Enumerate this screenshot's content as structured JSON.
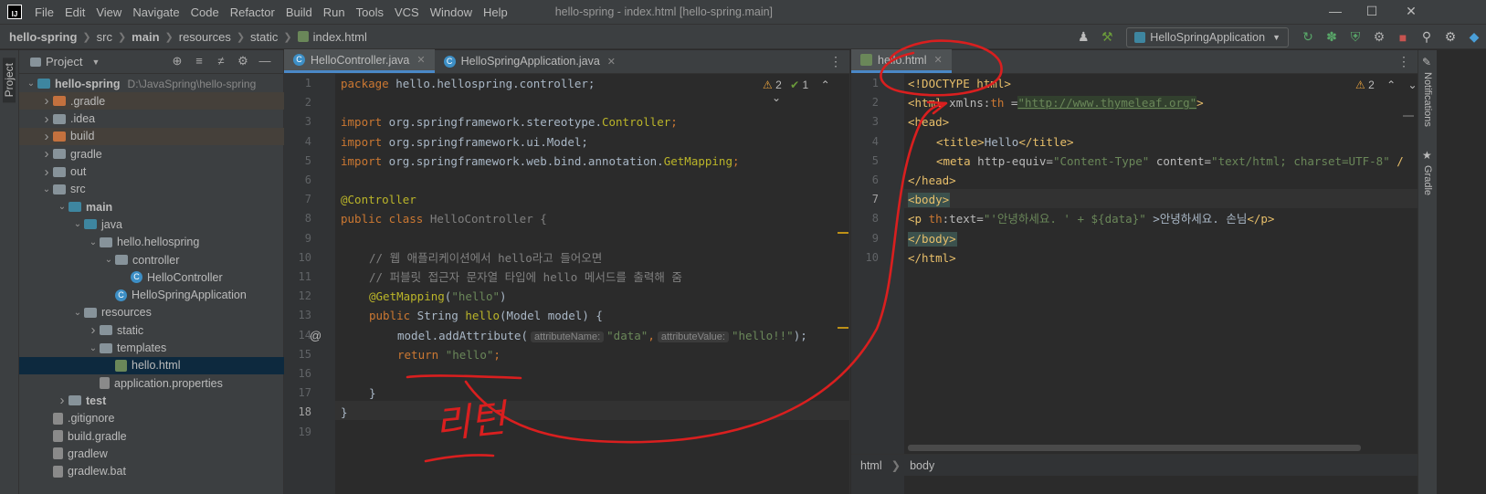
{
  "menubar": {
    "logo_text": "IJ",
    "items": [
      "File",
      "Edit",
      "View",
      "Navigate",
      "Code",
      "Refactor",
      "Build",
      "Run",
      "Tools",
      "VCS",
      "Window",
      "Help"
    ],
    "window_title": "hello-spring - index.html [hello-spring.main]"
  },
  "navbar": {
    "crumbs": [
      "hello-spring",
      "src",
      "main",
      "resources",
      "static",
      "index.html"
    ],
    "run_config": "HelloSpringApplication"
  },
  "left_strip": {
    "label": "Project"
  },
  "project": {
    "title": "Project",
    "tree": [
      {
        "label": "hello-spring",
        "extra": "D:\\JavaSpring\\hello-spring",
        "bold": true,
        "depth": 0,
        "arrow": "v",
        "icon": "folder-blue"
      },
      {
        "label": ".gradle",
        "depth": 1,
        "arrow": ">",
        "icon": "folder-orange",
        "hl": "brown"
      },
      {
        "label": ".idea",
        "depth": 1,
        "arrow": ">",
        "icon": "folder"
      },
      {
        "label": "build",
        "depth": 1,
        "arrow": ">",
        "icon": "folder-orange",
        "hl": "brown"
      },
      {
        "label": "gradle",
        "depth": 1,
        "arrow": ">",
        "icon": "folder"
      },
      {
        "label": "out",
        "depth": 1,
        "arrow": ">",
        "icon": "folder"
      },
      {
        "label": "src",
        "depth": 1,
        "arrow": "v",
        "icon": "folder"
      },
      {
        "label": "main",
        "depth": 2,
        "arrow": "v",
        "icon": "folder-blue",
        "bold": true
      },
      {
        "label": "java",
        "depth": 3,
        "arrow": "v",
        "icon": "folder-blue"
      },
      {
        "label": "hello.hellospring",
        "depth": 4,
        "arrow": "v",
        "icon": "folder"
      },
      {
        "label": "controller",
        "depth": 5,
        "arrow": "v",
        "icon": "folder"
      },
      {
        "label": "HelloController",
        "depth": 6,
        "arrow": "",
        "icon": "class"
      },
      {
        "label": "HelloSpringApplication",
        "depth": 5,
        "arrow": "",
        "icon": "class"
      },
      {
        "label": "resources",
        "depth": 3,
        "arrow": "v",
        "icon": "folder"
      },
      {
        "label": "static",
        "depth": 4,
        "arrow": ">",
        "icon": "folder"
      },
      {
        "label": "templates",
        "depth": 4,
        "arrow": "v",
        "icon": "folder"
      },
      {
        "label": "hello.html",
        "depth": 5,
        "arrow": "",
        "icon": "html",
        "hl": "sel"
      },
      {
        "label": "application.properties",
        "depth": 4,
        "arrow": "",
        "icon": "file"
      },
      {
        "label": "test",
        "depth": 2,
        "arrow": ">",
        "icon": "folder",
        "bold": true
      },
      {
        "label": ".gitignore",
        "depth": 1,
        "arrow": "",
        "icon": "file"
      },
      {
        "label": "build.gradle",
        "depth": 1,
        "arrow": "",
        "icon": "file"
      },
      {
        "label": "gradlew",
        "depth": 1,
        "arrow": "",
        "icon": "file"
      },
      {
        "label": "gradlew.bat",
        "depth": 1,
        "arrow": "",
        "icon": "file"
      }
    ]
  },
  "editor1": {
    "tabs": [
      "HelloController.java",
      "HelloSpringApplication.java"
    ],
    "inspections": {
      "warnings": "2",
      "ok": "1"
    },
    "line_numbers": [
      "1",
      "2",
      "3",
      "4",
      "5",
      "6",
      "7",
      "8",
      "9",
      "10",
      "11",
      "12",
      "13",
      "14",
      "15",
      "16",
      "17",
      "18",
      "19"
    ],
    "gutter_at": "@",
    "lines": {
      "l1": [
        "package",
        " hello.hellospring.controller;"
      ],
      "l3": [
        "import",
        " org.springframework.stereotype.",
        "Controller",
        ";"
      ],
      "l4": [
        "import",
        " org.springframework.ui.Model;"
      ],
      "l5": [
        "import",
        " org.springframework.web.bind.annotation.",
        "GetMapping",
        ";"
      ],
      "l7": "@Controller",
      "l8": [
        "public class",
        " HelloController {"
      ],
      "l10": "// 웹 애플리케이션에서 hello라고 들어오면",
      "l11": "// 퍼블릿 접근자 문자열 타입에 hello 메서드를 출력해 줌",
      "l12": [
        "@GetMapping",
        "(",
        "\"hello\"",
        ")"
      ],
      "l13": [
        "public",
        " String ",
        "hello",
        "(Model model) {"
      ],
      "l14": [
        "model.addAttribute(",
        "attributeName:",
        "\"data\"",
        ",",
        "attributeValue:",
        "\"hello!!\"",
        ");"
      ],
      "l15": [
        "return",
        " ",
        "\"hello\"",
        ";"
      ],
      "l17": "}",
      "l18": "}"
    }
  },
  "editor2": {
    "tab": "hello.html",
    "inspections": {
      "warnings": "2"
    },
    "line_numbers": [
      "1",
      "2",
      "3",
      "4",
      "5",
      "6",
      "7",
      "8",
      "9",
      "10"
    ],
    "lines": {
      "l1": "<!DOCTYPE html>",
      "l2": [
        "<html",
        " xmlns:",
        "th",
        " =",
        "\"http://www.thymeleaf.org\"",
        ">"
      ],
      "l3": "<head>",
      "l4": [
        "<title>",
        "Hello",
        "</title>"
      ],
      "l5": [
        "<meta",
        " http-equiv=",
        "\"Content-Type\"",
        " content=",
        "\"text/html; charset=UTF-8\"",
        " /"
      ],
      "l6": "</head>",
      "l7": "<body>",
      "l8": [
        "<p",
        " ",
        "th",
        ":text=",
        "\"'안녕하세요. ' + ${data}\"",
        " >안녕하세요. 손님",
        "</p>"
      ],
      "l9": "</body>",
      "l10": "</html>"
    },
    "breadcrumb": [
      "html",
      "body"
    ]
  },
  "right_strip": {
    "labels": [
      "Notifications",
      "Gradle"
    ]
  },
  "annotation": {
    "text": "리턴",
    "color": "#d91f1f"
  }
}
